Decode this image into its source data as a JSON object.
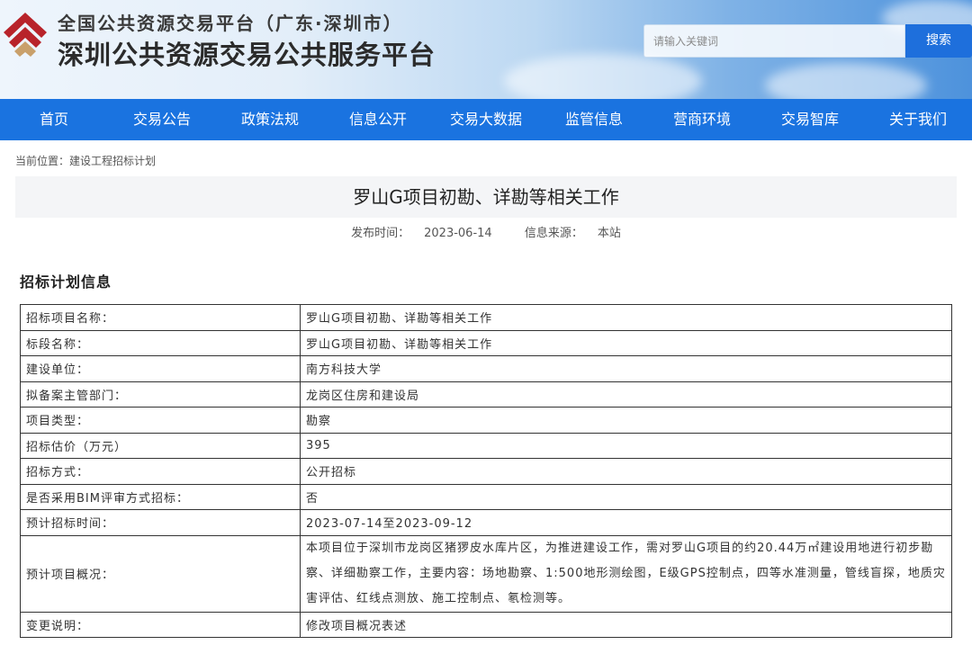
{
  "header": {
    "site_sub": "全国公共资源交易平台（广东·深圳市）",
    "site_title": "深圳公共资源交易公共服务平台",
    "search_placeholder": "请输入关键词",
    "search_button": "搜索"
  },
  "nav": {
    "items": [
      "首页",
      "交易公告",
      "政策法规",
      "信息公开",
      "交易大数据",
      "监管信息",
      "营商环境",
      "交易智库",
      "关于我们"
    ]
  },
  "breadcrumb": {
    "prefix": "当前位置：",
    "current": "建设工程招标计划"
  },
  "article": {
    "title": "罗山G项目初勘、详勘等相关工作",
    "publish_label": "发布时间：",
    "publish_date": "2023-06-14",
    "source_label": "信息来源：",
    "source": "本站"
  },
  "section": {
    "title": "招标计划信息"
  },
  "table": {
    "rows": [
      {
        "label": "招标项目名称：",
        "value": "罗山G项目初勘、详勘等相关工作"
      },
      {
        "label": "标段名称：",
        "value": "罗山G项目初勘、详勘等相关工作"
      },
      {
        "label": "建设单位：",
        "value": "南方科技大学"
      },
      {
        "label": "拟备案主管部门：",
        "value": "龙岗区住房和建设局"
      },
      {
        "label": "项目类型：",
        "value": "勘察"
      },
      {
        "label": "招标估价（万元）",
        "value": "395"
      },
      {
        "label": "招标方式：",
        "value": "公开招标"
      },
      {
        "label": "是否采用BIM评审方式招标：",
        "value": "否"
      },
      {
        "label": "预计招标时间：",
        "value": "2023-07-14至2023-09-12"
      },
      {
        "label": "预计项目概况：",
        "value": "本项目位于深圳市龙岗区猪猡皮水库片区，为推进建设工作，需对罗山G项目的约20.44万㎡建设用地进行初步勘察、详细勘察工作，主要内容：场地勘察、1:500地形测绘图，E级GPS控制点，四等水准测量，管线盲探，地质灾害评估、红线点测放、施工控制点、氡检测等。"
      },
      {
        "label": "变更说明：",
        "value": "修改项目概况表述"
      }
    ]
  },
  "colors": {
    "nav_bg": "#1a73e0",
    "search_button_bg": "#1e6fdc",
    "logo_red": "#b8232a",
    "logo_tan": "#c9a06b"
  },
  "icons": {
    "logo": "site-logo-icon"
  }
}
